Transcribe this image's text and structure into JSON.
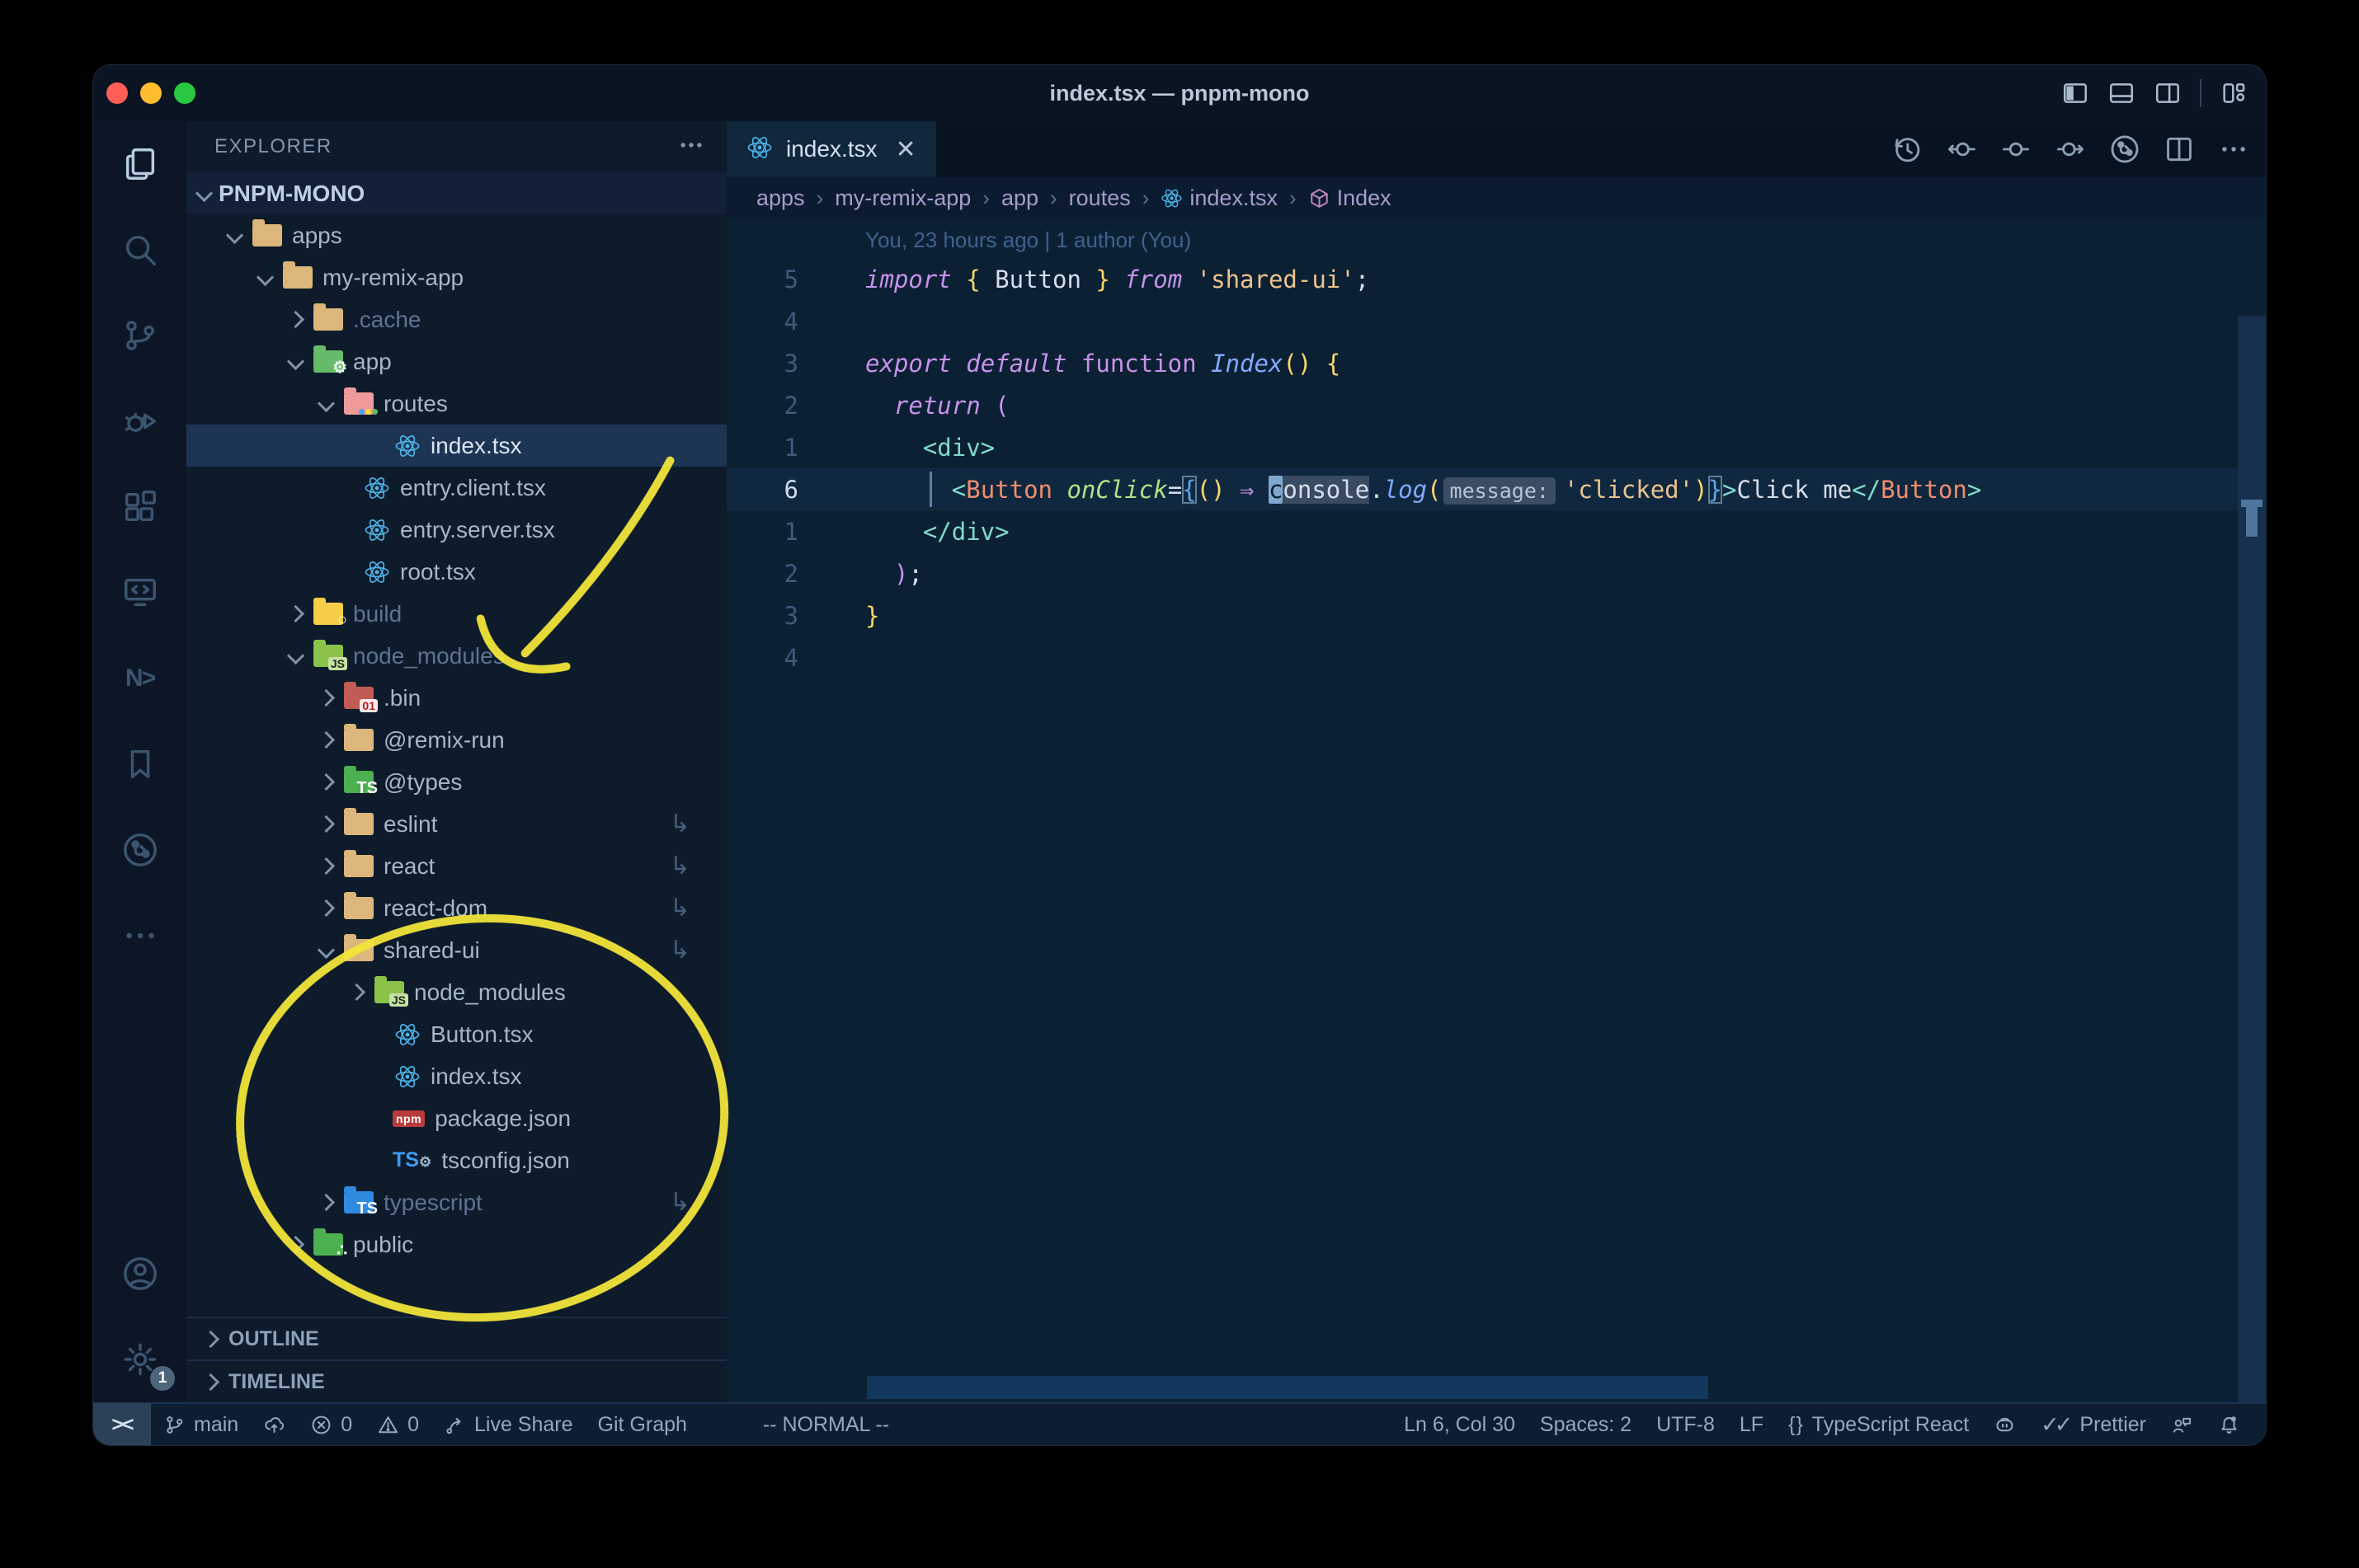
{
  "window": {
    "title": "index.tsx — pnpm-mono"
  },
  "colors": {
    "annotation_yellow": "#f3e53a",
    "traffic_close": "#ff5f57",
    "traffic_minimize": "#febc2e",
    "traffic_zoom": "#28c840",
    "folder_tan": "#dcb67a",
    "folder_green": "#66bb6a",
    "folder_routes": "#ef9a9a",
    "folder_build": "#f5cd47",
    "folder_node": "#8bc34a",
    "folder_bin": "#c25b56",
    "folder_types": "#4caf50",
    "folder_ts": "#2f8be0",
    "folder_public": "#4caf50",
    "react_blue": "#4fb3e8",
    "npm_red": "#b93c3c",
    "selected_row": "#1d3452"
  },
  "titlebar": {
    "layout_icons": [
      "toggle-sidebar-icon",
      "toggle-panel-icon",
      "toggle-secondary-sidebar-icon",
      "customize-layout-icon"
    ]
  },
  "activity_bar": {
    "top": [
      {
        "name": "explorer",
        "icon": "files-icon",
        "active": true
      },
      {
        "name": "search",
        "icon": "search-icon"
      },
      {
        "name": "source-control",
        "icon": "source-control-icon"
      },
      {
        "name": "run-debug",
        "icon": "debug-icon"
      },
      {
        "name": "extensions",
        "icon": "extensions-icon"
      },
      {
        "name": "remote-explorer",
        "icon": "remote-explorer-icon"
      },
      {
        "name": "nx-console",
        "icon": "nx-icon"
      },
      {
        "name": "bookmarks",
        "icon": "bookmark-icon"
      },
      {
        "name": "git-graph",
        "icon": "git-graph-icon"
      },
      {
        "name": "more",
        "icon": "ellipsis-icon"
      }
    ],
    "bottom": [
      {
        "name": "accounts",
        "icon": "account-icon"
      },
      {
        "name": "settings",
        "icon": "gear-icon",
        "badge": "1"
      }
    ]
  },
  "explorer": {
    "title": "EXPLORER",
    "root_label": "PNPM-MONO",
    "tree": [
      {
        "label": "apps",
        "icon": "folder-tan",
        "depth": 1,
        "chevron": "down"
      },
      {
        "label": "my-remix-app",
        "icon": "folder-tan",
        "depth": 2,
        "chevron": "down"
      },
      {
        "label": ".cache",
        "icon": "folder-tan",
        "depth": 3,
        "chevron": "right",
        "dim": true
      },
      {
        "label": "app",
        "icon": "folder-app",
        "depth": 3,
        "chevron": "down"
      },
      {
        "label": "routes",
        "icon": "folder-routes",
        "depth": 4,
        "chevron": "down"
      },
      {
        "label": "index.tsx",
        "icon": "react",
        "depth": 5,
        "selected": true
      },
      {
        "label": "entry.client.tsx",
        "icon": "react",
        "depth": 4
      },
      {
        "label": "entry.server.tsx",
        "icon": "react",
        "depth": 4
      },
      {
        "label": "root.tsx",
        "icon": "react",
        "depth": 4
      },
      {
        "label": "build",
        "icon": "folder-build",
        "depth": 3,
        "chevron": "right",
        "dim": true
      },
      {
        "label": "node_modules",
        "icon": "folder-node",
        "depth": 3,
        "chevron": "down",
        "dim": true
      },
      {
        "label": ".bin",
        "icon": "folder-bin",
        "depth": 4,
        "chevron": "right"
      },
      {
        "label": "@remix-run",
        "icon": "folder-tan",
        "depth": 4,
        "chevron": "right"
      },
      {
        "label": "@types",
        "icon": "folder-types",
        "depth": 4,
        "chevron": "right"
      },
      {
        "label": "eslint",
        "icon": "folder-tan",
        "depth": 4,
        "chevron": "right",
        "symlink": true
      },
      {
        "label": "react",
        "icon": "folder-tan",
        "depth": 4,
        "chevron": "right",
        "symlink": true
      },
      {
        "label": "react-dom",
        "icon": "folder-tan",
        "depth": 4,
        "chevron": "right",
        "symlink": true
      },
      {
        "label": "shared-ui",
        "icon": "folder-tan",
        "depth": 4,
        "chevron": "down",
        "symlink": true
      },
      {
        "label": "node_modules",
        "icon": "folder-node",
        "depth": 5,
        "chevron": "right"
      },
      {
        "label": "Button.tsx",
        "icon": "react",
        "depth": 5
      },
      {
        "label": "index.tsx",
        "icon": "react",
        "depth": 5
      },
      {
        "label": "package.json",
        "icon": "npm",
        "depth": 5
      },
      {
        "label": "tsconfig.json",
        "icon": "tsconfig",
        "depth": 5
      },
      {
        "label": "typescript",
        "icon": "folder-ts",
        "depth": 4,
        "chevron": "right",
        "symlink": true,
        "dim": true
      },
      {
        "label": "public",
        "icon": "folder-public",
        "depth": 3,
        "chevron": "right"
      }
    ],
    "sections": [
      {
        "label": "OUTLINE"
      },
      {
        "label": "TIMELINE"
      }
    ]
  },
  "editor": {
    "tab": {
      "label": "index.tsx",
      "icon": "react",
      "close": "✕"
    },
    "toolbar_icons": [
      "history-icon",
      "prev-change-icon",
      "change-icon",
      "next-change-icon",
      "git-graph-icon",
      "split-editor-icon",
      "ellipsis-icon"
    ],
    "breadcrumbs": [
      {
        "label": "apps"
      },
      {
        "label": "my-remix-app"
      },
      {
        "label": "app"
      },
      {
        "label": "routes"
      },
      {
        "label": "index.tsx",
        "icon": "react"
      },
      {
        "label": "Index",
        "icon": "symbol-namespace-icon"
      }
    ],
    "blame": "You, 23 hours ago | 1 author (You)",
    "code_lines": [
      {
        "num": "5",
        "tokens": [
          [
            "import",
            "kw"
          ],
          [
            " ",
            "fg"
          ],
          [
            "{",
            "yb"
          ],
          [
            " ",
            "fg"
          ],
          [
            "Button",
            "fg"
          ],
          [
            " ",
            "fg"
          ],
          [
            "}",
            "yb"
          ],
          [
            " ",
            "fg"
          ],
          [
            "from",
            "kw"
          ],
          [
            " ",
            "fg"
          ],
          [
            "'shared-ui'",
            "str"
          ],
          [
            ";",
            "fg"
          ]
        ]
      },
      {
        "num": "4",
        "tokens": []
      },
      {
        "num": "3",
        "tokens": [
          [
            "export",
            "kw"
          ],
          [
            " ",
            "fg"
          ],
          [
            "default",
            "kw"
          ],
          [
            " ",
            "fg"
          ],
          [
            "function",
            "kwu"
          ],
          [
            " ",
            "fg"
          ],
          [
            "Index",
            "fni"
          ],
          [
            "()",
            "yb"
          ],
          [
            " ",
            "fg"
          ],
          [
            "{",
            "yb"
          ]
        ]
      },
      {
        "num": "2",
        "tokens": [
          [
            "  ",
            "fg"
          ],
          [
            "return",
            "kw"
          ],
          [
            " ",
            "fg"
          ],
          [
            "(",
            "pk"
          ]
        ]
      },
      {
        "num": "1",
        "tokens": [
          [
            "    ",
            "fg"
          ],
          [
            "<div>",
            "tag"
          ]
        ]
      },
      {
        "num": "6",
        "current": true,
        "tokens": [
          [
            "      ",
            "fg"
          ],
          [
            "<",
            "tag"
          ],
          [
            "Button",
            "cmp"
          ],
          [
            " ",
            "fg"
          ],
          [
            "onClick",
            "attr"
          ],
          [
            "=",
            "fg"
          ],
          [
            "{",
            "bm"
          ],
          [
            "()",
            "yb"
          ],
          [
            " ",
            "fg"
          ],
          [
            "⇒",
            "kw"
          ],
          [
            " ",
            "fg"
          ],
          [
            "c",
            "cursor"
          ],
          [
            "onsole",
            "whl"
          ],
          [
            ".",
            "fg"
          ],
          [
            "log",
            "fni"
          ],
          [
            "(",
            "yb"
          ],
          [
            "message:",
            "inlay"
          ],
          [
            "'clicked'",
            "str"
          ],
          [
            ")",
            "yb"
          ],
          [
            "}",
            "bm"
          ],
          [
            ">",
            "tag"
          ],
          [
            "Click me",
            "fg"
          ],
          [
            "</",
            "tag"
          ],
          [
            "Button",
            "cmp"
          ],
          [
            ">",
            "tag"
          ]
        ]
      },
      {
        "num": "1",
        "tokens": [
          [
            "    ",
            "fg"
          ],
          [
            "</div>",
            "tag"
          ]
        ]
      },
      {
        "num": "2",
        "tokens": [
          [
            "  ",
            "fg"
          ],
          [
            ")",
            "pk"
          ],
          [
            ";",
            "fg"
          ]
        ]
      },
      {
        "num": "3",
        "tokens": [
          [
            "}",
            "yb"
          ]
        ]
      },
      {
        "num": "4",
        "tokens": []
      }
    ]
  },
  "statusbar": {
    "left": [
      {
        "name": "remote",
        "icon": "remote-icon",
        "label": "><"
      },
      {
        "name": "branch",
        "icon": "branch-icon",
        "label": "main"
      },
      {
        "name": "publish",
        "icon": "cloud-upload-icon",
        "label": ""
      },
      {
        "name": "problems-errors",
        "icon": "error-icon",
        "label": "0"
      },
      {
        "name": "problems-warnings",
        "icon": "warning-icon",
        "label": "0"
      },
      {
        "name": "live-share",
        "icon": "live-share-icon",
        "label": "Live Share"
      },
      {
        "name": "git-graph",
        "label": "Git Graph"
      },
      {
        "name": "vim-mode",
        "label": "-- NORMAL --"
      }
    ],
    "right": [
      {
        "name": "cursor-position",
        "label": "Ln 6, Col 30"
      },
      {
        "name": "indentation",
        "label": "Spaces: 2"
      },
      {
        "name": "encoding",
        "label": "UTF-8"
      },
      {
        "name": "eol",
        "label": "LF"
      },
      {
        "name": "language-mode",
        "icon": "braces-icon",
        "label": "TypeScript React"
      },
      {
        "name": "copilot",
        "icon": "copilot-icon",
        "label": ""
      },
      {
        "name": "prettier",
        "icon": "double-check-icon",
        "label": "Prettier"
      },
      {
        "name": "feedback",
        "icon": "feedback-icon",
        "label": ""
      },
      {
        "name": "notifications",
        "icon": "bell-icon",
        "label": ""
      }
    ]
  }
}
